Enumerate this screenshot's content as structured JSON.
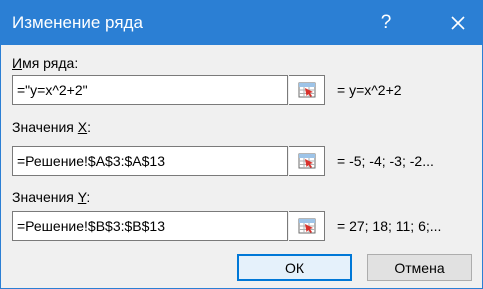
{
  "dialog": {
    "title": "Изменение ряда",
    "help_label": "?"
  },
  "fields": [
    {
      "label_prefix": "",
      "label_key": "И",
      "label_rest": "мя ряда:",
      "value": "=\"y=x^2+2\"",
      "preview": "= y=x^2+2"
    },
    {
      "label_prefix": "Значения ",
      "label_key": "X",
      "label_rest": ":",
      "value": "=Решение!$A$3:$A$13",
      "preview": "= -5; -4; -3; -2..."
    },
    {
      "label_prefix": "Значения ",
      "label_key": "Y",
      "label_rest": ":",
      "value": "=Решение!$B$3:$B$13",
      "preview": "= 27; 18; 11; 6;..."
    }
  ],
  "buttons": {
    "ok": "ОК",
    "cancel": "Отмена"
  },
  "colors": {
    "titlebar": "#2b7fd4",
    "dialog_bg": "#f0f0f0",
    "ok_border": "#0078d7"
  },
  "icons": [
    "help-icon",
    "close-icon",
    "range-collapse-icon"
  ]
}
